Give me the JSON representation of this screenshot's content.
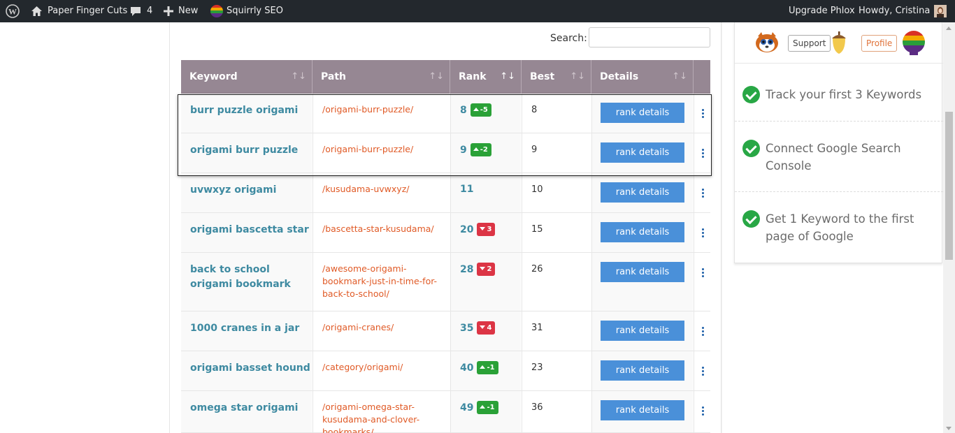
{
  "adminbar": {
    "site_name": "Paper Finger Cuts",
    "comments_count": "4",
    "new_label": "New",
    "squirrly_label": "Squirrly SEO",
    "upgrade_label": "Upgrade Phlox",
    "howdy_label": "Howdy, Cristina"
  },
  "search": {
    "label": "Search:",
    "value": "",
    "placeholder": ""
  },
  "table": {
    "columns": [
      "Keyword",
      "Path",
      "Rank",
      "Best",
      "Details"
    ],
    "sort_glyph": "↑↓",
    "rows": [
      {
        "keyword": "burr puzzle origami",
        "path": "/origami-burr-puzzle/",
        "rank": "8",
        "change": "-5",
        "trend": "up",
        "best": "8",
        "details": "rank details"
      },
      {
        "keyword": "origami burr puzzle",
        "path": "/origami-burr-puzzle/",
        "rank": "9",
        "change": "-2",
        "trend": "up",
        "best": "9",
        "details": "rank details"
      },
      {
        "keyword": "uvwxyz origami",
        "path": "/kusudama-uvwxyz/",
        "rank": "11",
        "change": "",
        "trend": "none",
        "best": "10",
        "details": "rank details"
      },
      {
        "keyword": "origami bascetta star",
        "path": "/bascetta-star-kusudama/",
        "rank": "20",
        "change": "3",
        "trend": "down",
        "best": "15",
        "details": "rank details"
      },
      {
        "keyword": "back to school origami bookmark",
        "path": "/awesome-origami-bookmark-just-in-time-for-back-to-school/",
        "rank": "28",
        "change": "2",
        "trend": "down",
        "best": "26",
        "details": "rank details"
      },
      {
        "keyword": "1000 cranes in a jar",
        "path": "/origami-cranes/",
        "rank": "35",
        "change": "4",
        "trend": "down",
        "best": "31",
        "details": "rank details"
      },
      {
        "keyword": "origami basset hound",
        "path": "/category/origami/",
        "rank": "40",
        "change": "-1",
        "trend": "up",
        "best": "23",
        "details": "rank details"
      },
      {
        "keyword": "omega star origami",
        "path": "/origami-omega-star-kusudama-and-clover-bookmarks/",
        "rank": "49",
        "change": "-1",
        "trend": "up",
        "best": "36",
        "details": "rank details"
      }
    ]
  },
  "panel": {
    "support_label": "Support",
    "profile_label": "Profile",
    "tasks": [
      "Track your first 3 Keywords",
      "Connect Google Search Console",
      "Get 1 Keyword to the first page of Google"
    ]
  },
  "colors": {
    "header": "#968793",
    "link": "#3e8aa1",
    "path": "#e05a26",
    "button": "#4a90d9",
    "up": "#2aa137",
    "down": "#dc3545",
    "check": "#28a745"
  },
  "icons": [
    "wordpress-logo-icon",
    "home-icon",
    "comment-icon",
    "plus-icon",
    "squirrly-icon",
    "avatar",
    "squirrel-mascot-icon",
    "acorn-icon",
    "profile-avatar-icon",
    "check-icon",
    "kebab-menu-icon"
  ]
}
